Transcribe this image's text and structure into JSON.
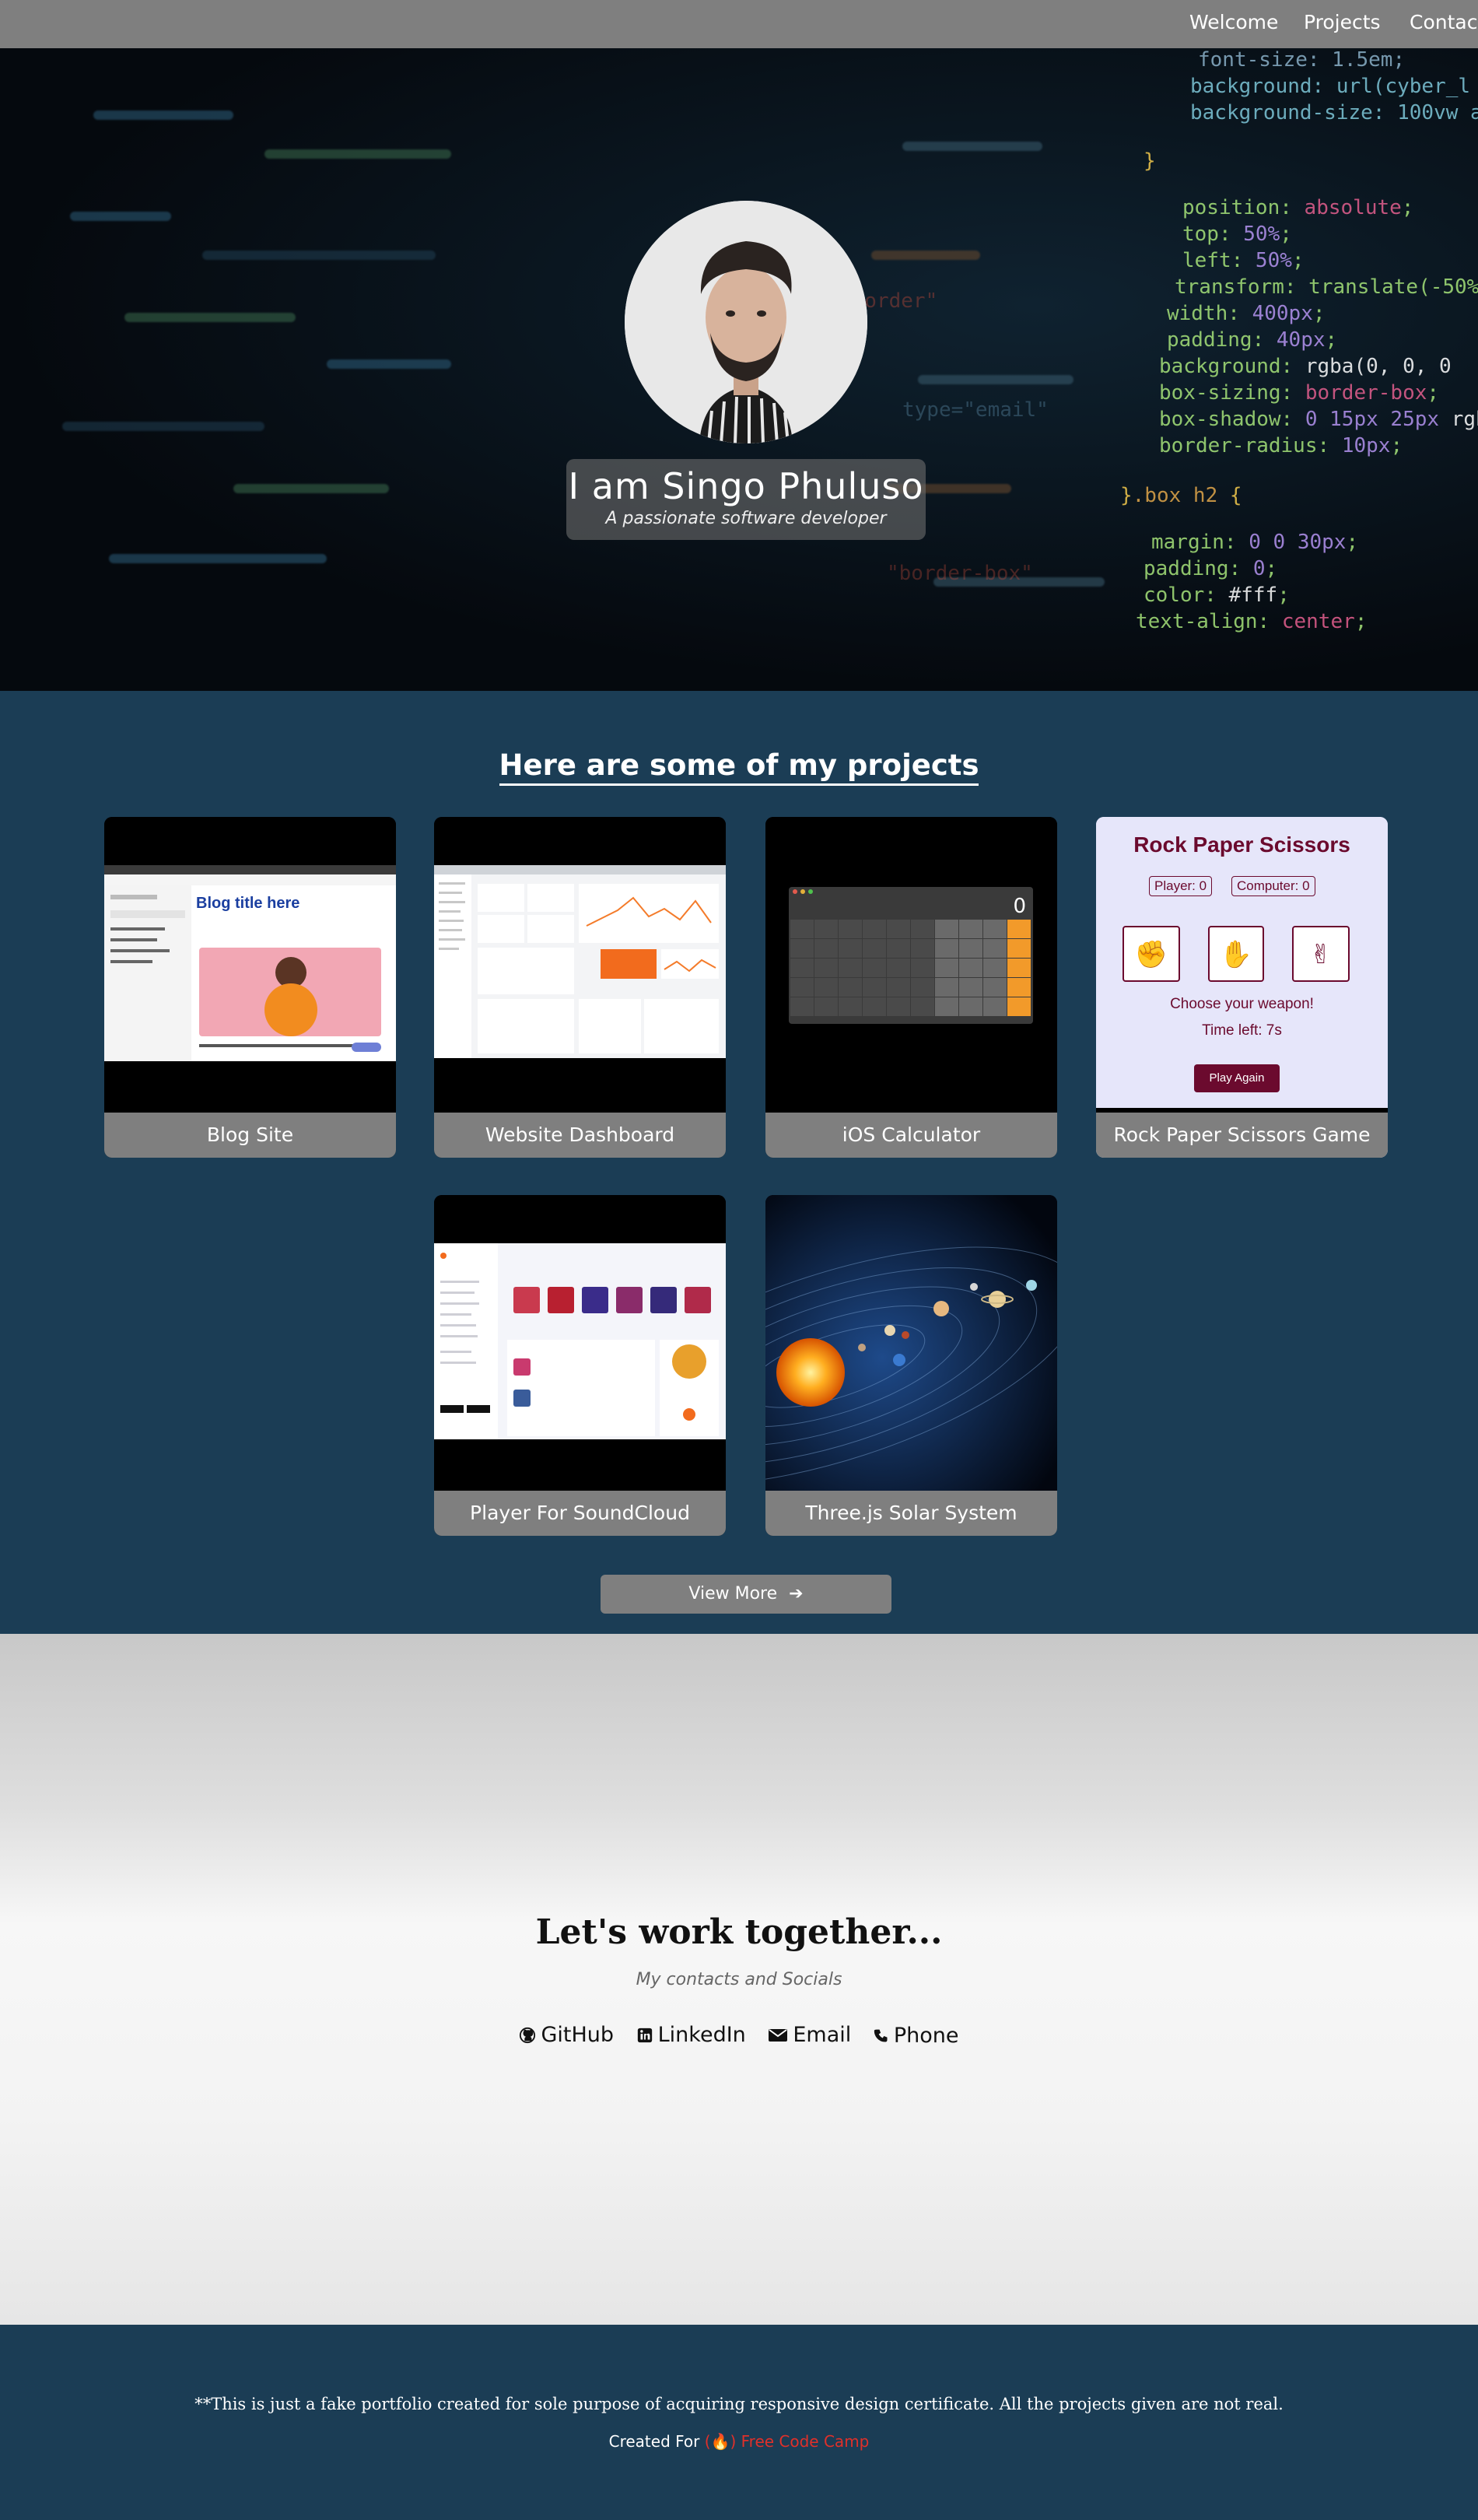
{
  "nav": {
    "items": [
      "Welcome",
      "Projects",
      "Contact"
    ]
  },
  "hero": {
    "name": "I am Singo Phuluso",
    "tagline": "A passionate software developer"
  },
  "projects": {
    "heading": "Here are some of my projects",
    "cards": [
      {
        "label": "Blog Site"
      },
      {
        "label": "Website Dashboard"
      },
      {
        "label": "iOS Calculator"
      },
      {
        "label": "Rock Paper Scissors Game"
      },
      {
        "label": "Player For SoundCloud"
      },
      {
        "label": "Three.js Solar System"
      }
    ],
    "view_more": "View More",
    "blog_thumb_title": "Blog title here",
    "calc_display": "0",
    "rps": {
      "title": "Rock Paper Scissors",
      "player_score": "Player: 0",
      "computer_score": "Computer: 0",
      "prompt": "Choose your weapon!",
      "timer": "Time left: 7s",
      "button": "Play Again"
    }
  },
  "contact": {
    "title": "Let's work together...",
    "subtitle": "My contacts and Socials",
    "links": [
      "GitHub",
      "LinkedIn",
      "Email",
      "Phone"
    ]
  },
  "footer": {
    "disclaimer": "**This is just a fake portfolio created for sole purpose of acquiring responsive design certificate. All the projects given are not real.",
    "credit_prefix": "Created For",
    "credit_link": "Free Code Camp"
  },
  "colors": {
    "nav_bg": "#7f7f7f",
    "section_bg": "#1b3d55",
    "card_label_bg": "#7f7f7f",
    "accent_red": "#e0302a",
    "rps_maroon": "#6b0a2e"
  }
}
